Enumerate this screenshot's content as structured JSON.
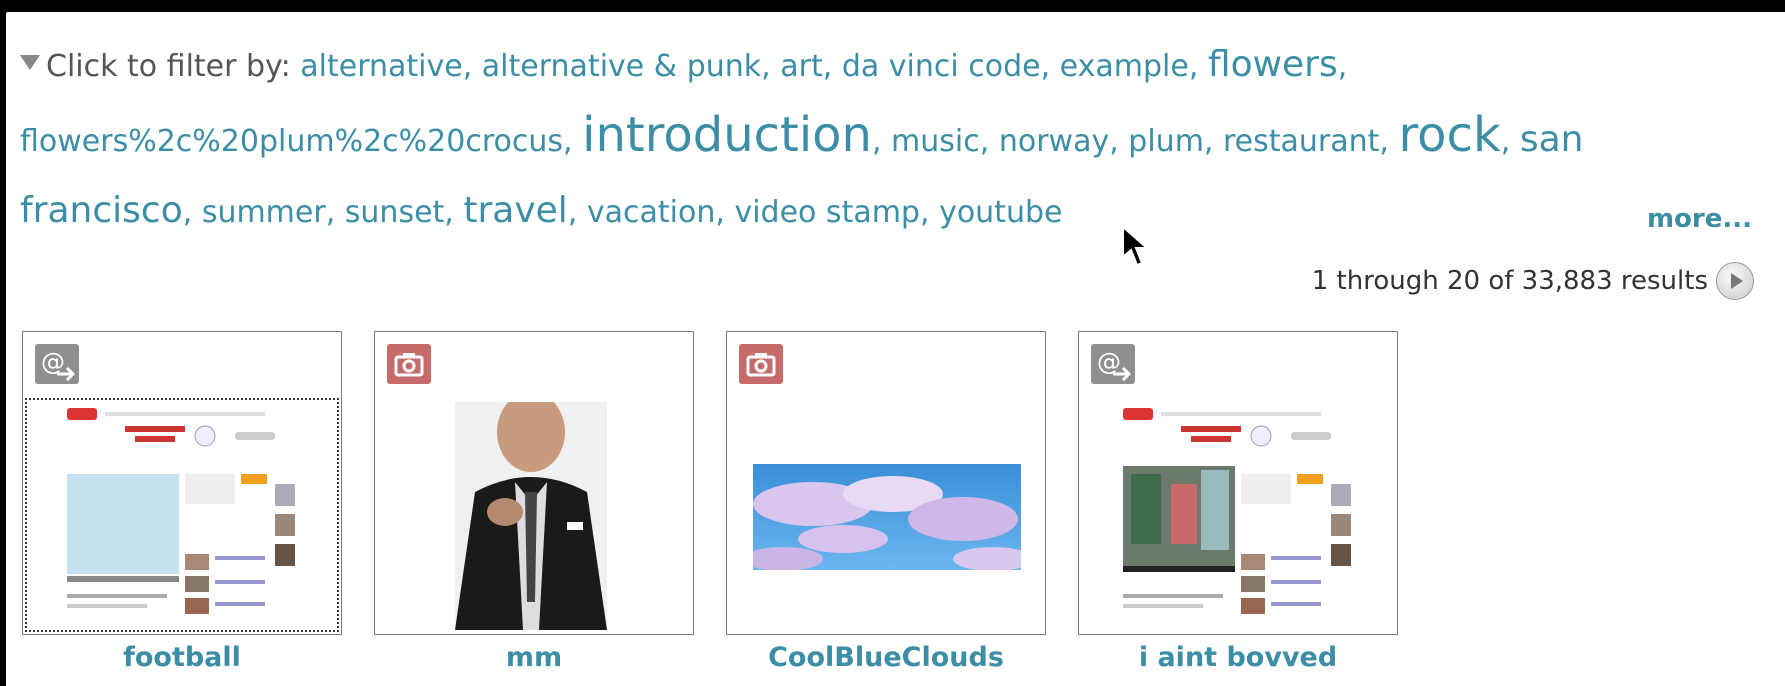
{
  "filter": {
    "label": "Click to filter by: ",
    "tags": [
      {
        "text": "alternative",
        "size": 1
      },
      {
        "text": "alternative & punk",
        "size": 1
      },
      {
        "text": "art",
        "size": 1
      },
      {
        "text": "da vinci code",
        "size": 1
      },
      {
        "text": "example",
        "size": 1
      },
      {
        "text": "flowers",
        "size": 2
      },
      {
        "text": "flowers%2c%20plum%2c%20crocus",
        "size": 1
      },
      {
        "text": "introduction",
        "size": 3
      },
      {
        "text": "music",
        "size": 1
      },
      {
        "text": "norway",
        "size": 1
      },
      {
        "text": "plum",
        "size": 1
      },
      {
        "text": "restaurant",
        "size": 1
      },
      {
        "text": "rock",
        "size": 3
      },
      {
        "text": "san francisco",
        "size": 2
      },
      {
        "text": "summer",
        "size": 1
      },
      {
        "text": "sunset",
        "size": 1
      },
      {
        "text": "travel",
        "size": 2
      },
      {
        "text": "vacation",
        "size": 1
      },
      {
        "text": "video stamp",
        "size": 1
      },
      {
        "text": "youtube",
        "size": 1
      }
    ],
    "more_label": "more..."
  },
  "results": {
    "summary": "1 through 20 of 33,883 results"
  },
  "items": [
    {
      "title": "football",
      "type": "video",
      "icon": "at-arrow-icon"
    },
    {
      "title": "mm",
      "type": "photo",
      "icon": "camera-icon"
    },
    {
      "title": "CoolBlueClouds",
      "type": "photo",
      "icon": "camera-icon"
    },
    {
      "title": "i aint bovved",
      "type": "video",
      "icon": "at-arrow-icon"
    }
  ],
  "colors": {
    "tag_link": "#3b8ea5",
    "video_badge": "#8f8f8f",
    "photo_badge": "#c56b6b"
  }
}
